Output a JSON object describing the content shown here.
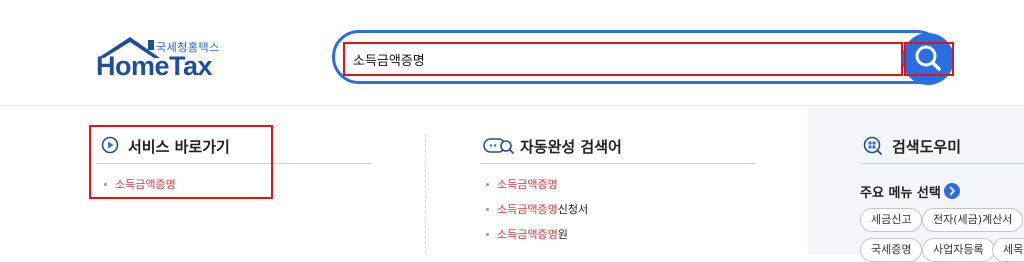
{
  "header": {
    "tagline": "국세청홈택스",
    "brand": "HomeTax"
  },
  "search": {
    "value": "소득금액증명",
    "button_label": "검색"
  },
  "service_shortcut": {
    "title": "서비스 바로가기",
    "items": [
      {
        "highlight": "소득금액증명",
        "rest": ""
      }
    ]
  },
  "autocomplete": {
    "title": "자동완성 검색어",
    "items": [
      {
        "highlight": "소득금액증명",
        "rest": ""
      },
      {
        "highlight": "소득금액증명",
        "rest": "신청서"
      },
      {
        "highlight": "소득금액증명",
        "rest": "원"
      }
    ]
  },
  "search_helper": {
    "title": "검색도우미",
    "menu_label": "주요 메뉴 선택",
    "chips": [
      "세금신고",
      "전자(세금)계산서",
      "국세증명",
      "사업자등록",
      "세목별"
    ]
  },
  "colors": {
    "accent": "#2a6fe0",
    "brand": "#1f4f9c",
    "highlight_text": "#e0343c",
    "annotation_red": "#e0141d"
  }
}
